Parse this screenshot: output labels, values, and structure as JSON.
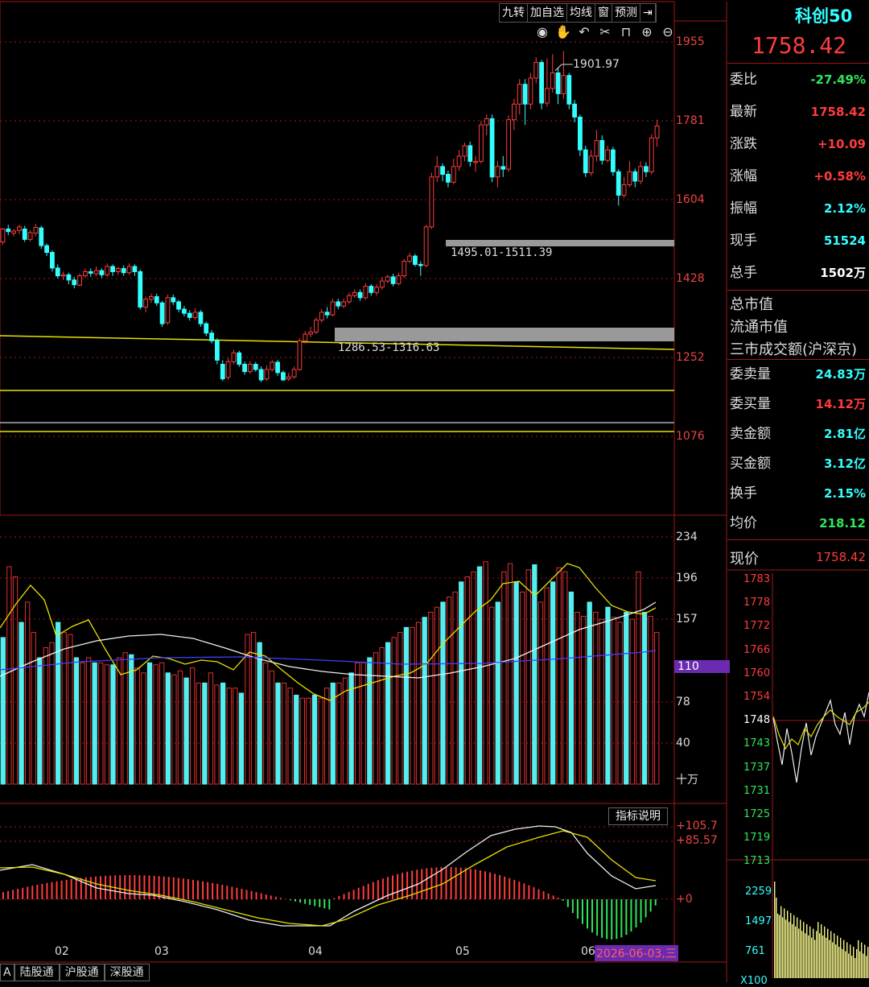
{
  "toolbar": {
    "buttons": [
      "九转",
      "加自选",
      "均线",
      "窗",
      "预测"
    ],
    "icons": [
      "eye-icon",
      "hand-icon",
      "undo-icon",
      "scissors-icon",
      "lock-icon",
      "zoom-in-icon",
      "zoom-out-icon"
    ]
  },
  "stock": {
    "name": "科创50",
    "price": "1758.42"
  },
  "quote_rows": [
    {
      "key": "委比",
      "value": "-27.49%",
      "color": "#2ee65a"
    },
    {
      "key": "最新",
      "value": "1758.42",
      "color": "#ff3c3c"
    },
    {
      "key": "涨跌",
      "value": "+10.09",
      "color": "#ff3c3c"
    },
    {
      "key": "涨幅",
      "value": "+0.58%",
      "color": "#ff3c3c"
    },
    {
      "key": "振幅",
      "value": "2.12%",
      "color": "#33ffff"
    },
    {
      "key": "现手",
      "value": "51524",
      "color": "#33ffff"
    },
    {
      "key": "总手",
      "value": "1502万",
      "color": "#ffffff"
    }
  ],
  "info_rows": [
    "总市值",
    "流通市值",
    "三市成交额(沪深京)"
  ],
  "quote_rows2": [
    {
      "key": "委卖量",
      "value": "24.83万",
      "color": "#33ffff"
    },
    {
      "key": "委买量",
      "value": "14.12万",
      "color": "#ff3c3c"
    },
    {
      "key": "卖金额",
      "value": "2.81亿",
      "color": "#33ffff"
    },
    {
      "key": "买金额",
      "value": "3.12亿",
      "color": "#33ffff"
    },
    {
      "key": "换手",
      "value": "2.15%",
      "color": "#33ffff"
    },
    {
      "key": "均价",
      "value": "218.12",
      "color": "#2ee65a"
    }
  ],
  "now_price": {
    "key": "现价",
    "value": "1758.42"
  },
  "price_axis": [
    "1955",
    "1781",
    "1604",
    "1428",
    "1252",
    "1076"
  ],
  "vol_axis": [
    "234",
    "196",
    "157",
    "110",
    "78",
    "40"
  ],
  "vol_highlight": "110",
  "vol_unit": "十万",
  "macd_axis": [
    "+105.7",
    "+85.57",
    "+0"
  ],
  "annotations": {
    "high": "1901.97",
    "gap1": "1495.01-1511.39",
    "gap2": "1286.53-1316.63"
  },
  "indicator_btn": "指标说明",
  "months": [
    "02",
    "03",
    "04",
    "05",
    "06"
  ],
  "date_label": "2026-06-03,三",
  "tabs": [
    "A",
    "陆股通",
    "沪股通",
    "深股通"
  ],
  "mini_axis": [
    "1783",
    "1778",
    "1772",
    "1766",
    "1760",
    "1754",
    "1748",
    "1743",
    "1737",
    "1731",
    "1725",
    "1719",
    "1713"
  ],
  "mini_vol_axis": [
    "2259",
    "1497",
    "761",
    "X100"
  ],
  "chart_data": {
    "type": "candlestick",
    "candles": [
      [
        1535,
        1560,
        1530,
        1562
      ],
      [
        1560,
        1555,
        1548,
        1568
      ],
      [
        1552,
        1556,
        1546,
        1560
      ],
      [
        1557,
        1564,
        1550,
        1568
      ],
      [
        1560,
        1540,
        1535,
        1566
      ],
      [
        1540,
        1553,
        1536,
        1558
      ],
      [
        1552,
        1563,
        1546,
        1570
      ],
      [
        1562,
        1528,
        1522,
        1566
      ],
      [
        1528,
        1515,
        1508,
        1532
      ],
      [
        1515,
        1485,
        1478,
        1519
      ],
      [
        1485,
        1470,
        1465,
        1492
      ],
      [
        1470,
        1472,
        1462,
        1478
      ],
      [
        1472,
        1462,
        1454,
        1476
      ],
      [
        1462,
        1453,
        1446,
        1468
      ],
      [
        1452,
        1470,
        1450,
        1475
      ],
      [
        1470,
        1478,
        1466,
        1484
      ],
      [
        1478,
        1475,
        1468,
        1484
      ],
      [
        1474,
        1480,
        1470,
        1488
      ],
      [
        1480,
        1472,
        1466,
        1484
      ],
      [
        1472,
        1488,
        1468,
        1494
      ],
      [
        1488,
        1478,
        1470,
        1492
      ],
      [
        1478,
        1484,
        1472,
        1488
      ],
      [
        1484,
        1476,
        1470,
        1490
      ],
      [
        1476,
        1488,
        1472,
        1494
      ],
      [
        1488,
        1478,
        1470,
        1492
      ],
      [
        1478,
        1410,
        1405,
        1482
      ],
      [
        1410,
        1425,
        1400,
        1430
      ],
      [
        1425,
        1430,
        1418,
        1436
      ],
      [
        1430,
        1418,
        1412,
        1436
      ],
      [
        1418,
        1378,
        1372,
        1422
      ],
      [
        1380,
        1428,
        1376,
        1434
      ],
      [
        1428,
        1420,
        1414,
        1434
      ],
      [
        1420,
        1406,
        1400,
        1424
      ],
      [
        1406,
        1398,
        1392,
        1412
      ],
      [
        1398,
        1390,
        1384,
        1404
      ],
      [
        1390,
        1400,
        1385,
        1408
      ],
      [
        1400,
        1378,
        1372,
        1404
      ],
      [
        1378,
        1360,
        1354,
        1382
      ],
      [
        1360,
        1345,
        1340,
        1366
      ],
      [
        1345,
        1308,
        1300,
        1350
      ],
      [
        1300,
        1272,
        1268,
        1308
      ],
      [
        1275,
        1305,
        1270,
        1312
      ],
      [
        1305,
        1322,
        1300,
        1328
      ],
      [
        1322,
        1300,
        1295,
        1326
      ],
      [
        1300,
        1286,
        1280,
        1305
      ],
      [
        1286,
        1300,
        1282,
        1306
      ],
      [
        1300,
        1290,
        1286,
        1304
      ],
      [
        1290,
        1270,
        1266,
        1296
      ],
      [
        1272,
        1290,
        1268,
        1298
      ],
      [
        1290,
        1304,
        1286,
        1308
      ],
      [
        1304,
        1284,
        1278,
        1308
      ],
      [
        1284,
        1270,
        1268,
        1288
      ],
      [
        1272,
        1276,
        1268,
        1284
      ],
      [
        1276,
        1290,
        1272,
        1296
      ],
      [
        1290,
        1345,
        1288,
        1350
      ],
      [
        1345,
        1358,
        1340,
        1364
      ],
      [
        1358,
        1362,
        1352,
        1372
      ],
      [
        1362,
        1385,
        1358,
        1390
      ],
      [
        1385,
        1400,
        1380,
        1406
      ],
      [
        1400,
        1395,
        1388,
        1410
      ],
      [
        1395,
        1420,
        1392,
        1426
      ],
      [
        1420,
        1412,
        1406,
        1426
      ],
      [
        1412,
        1420,
        1408,
        1426
      ],
      [
        1420,
        1432,
        1416,
        1438
      ],
      [
        1432,
        1438,
        1428,
        1444
      ],
      [
        1438,
        1428,
        1422,
        1444
      ],
      [
        1428,
        1450,
        1424,
        1456
      ],
      [
        1450,
        1438,
        1432,
        1454
      ],
      [
        1438,
        1448,
        1432,
        1454
      ],
      [
        1448,
        1460,
        1444,
        1468
      ],
      [
        1460,
        1468,
        1456,
        1472
      ],
      [
        1468,
        1455,
        1450,
        1474
      ],
      [
        1455,
        1470,
        1452,
        1476
      ],
      [
        1470,
        1498,
        1466,
        1502
      ],
      [
        1498,
        1508,
        1494,
        1514
      ],
      [
        1508,
        1492,
        1488,
        1512
      ],
      [
        1492,
        1490,
        1470,
        1498
      ],
      [
        1490,
        1564,
        1486,
        1568
      ],
      [
        1564,
        1660,
        1560,
        1668
      ],
      [
        1660,
        1680,
        1650,
        1700
      ],
      [
        1680,
        1665,
        1652,
        1686
      ],
      [
        1665,
        1650,
        1640,
        1672
      ],
      [
        1650,
        1680,
        1646,
        1695
      ],
      [
        1680,
        1700,
        1672,
        1712
      ],
      [
        1700,
        1720,
        1690,
        1726
      ],
      [
        1720,
        1690,
        1680,
        1728
      ],
      [
        1690,
        1690,
        1670,
        1700
      ],
      [
        1690,
        1760,
        1686,
        1768
      ],
      [
        1760,
        1772,
        1740,
        1780
      ],
      [
        1772,
        1660,
        1650,
        1780
      ],
      [
        1660,
        1680,
        1640,
        1690
      ],
      [
        1680,
        1675,
        1660,
        1700
      ],
      [
        1675,
        1770,
        1670,
        1778
      ],
      [
        1770,
        1800,
        1750,
        1810
      ],
      [
        1800,
        1838,
        1780,
        1848
      ],
      [
        1838,
        1800,
        1760,
        1848
      ],
      [
        1800,
        1850,
        1790,
        1860
      ],
      [
        1850,
        1880,
        1840,
        1890
      ],
      [
        1880,
        1802,
        1790,
        1885
      ],
      [
        1802,
        1830,
        1795,
        1888
      ],
      [
        1830,
        1860,
        1822,
        1896
      ],
      [
        1860,
        1820,
        1800,
        1870
      ],
      [
        1820,
        1855,
        1810,
        1902
      ],
      [
        1855,
        1800,
        1790,
        1860
      ],
      [
        1800,
        1775,
        1765,
        1808
      ],
      [
        1775,
        1712,
        1700,
        1780
      ],
      [
        1712,
        1668,
        1660,
        1720
      ],
      [
        1668,
        1700,
        1662,
        1712
      ],
      [
        1700,
        1730,
        1690,
        1750
      ],
      [
        1730,
        1692,
        1684,
        1740
      ],
      [
        1692,
        1712,
        1688,
        1720
      ],
      [
        1712,
        1670,
        1662,
        1718
      ],
      [
        1670,
        1625,
        1605,
        1675
      ],
      [
        1625,
        1645,
        1620,
        1660
      ],
      [
        1645,
        1670,
        1640,
        1690
      ],
      [
        1670,
        1652,
        1640,
        1676
      ],
      [
        1652,
        1680,
        1646,
        1690
      ],
      [
        1680,
        1670,
        1660,
        1688
      ],
      [
        1670,
        1735,
        1665,
        1742
      ],
      [
        1735,
        1758,
        1718,
        1770
      ]
    ],
    "volume": [
      145,
      215,
      205,
      160,
      180,
      150,
      125,
      135,
      140,
      160,
      150,
      148,
      125,
      120,
      125,
      120,
      120,
      118,
      118,
      125,
      130,
      128,
      115,
      110,
      120,
      118,
      120,
      110,
      108,
      112,
      105,
      115,
      100,
      100,
      110,
      98,
      100,
      95,
      95,
      90,
      148,
      150,
      140,
      120,
      112,
      100,
      100,
      95,
      88,
      85,
      85,
      88,
      85,
      95,
      100,
      100,
      105,
      110,
      120,
      120,
      125,
      130,
      135,
      140,
      145,
      150,
      155,
      155,
      160,
      165,
      170,
      175,
      180,
      185,
      190,
      200,
      205,
      210,
      215,
      220,
      175,
      180,
      210,
      218,
      200,
      190,
      212,
      217,
      180,
      194,
      200,
      214,
      210,
      190,
      170,
      166,
      180,
      170,
      163,
      175,
      165,
      160,
      170,
      163,
      210,
      170,
      166,
      150
    ],
    "vol_colors_up_red": true,
    "price_range": [
      1010,
      2000
    ],
    "vol_range": [
      0,
      250
    ]
  }
}
